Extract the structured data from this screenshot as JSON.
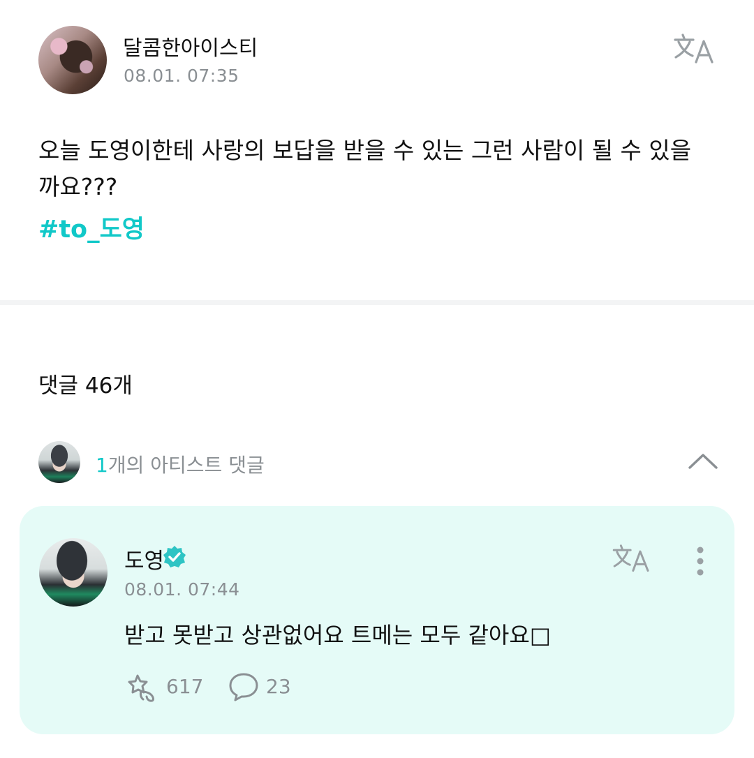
{
  "post": {
    "author": "달콤한아이스티",
    "time": "08.01. 07:35",
    "body": "오늘 도영이한테 사랑의 보답을 받을 수 있는 그런 사람이 될 수 있을까요???",
    "hashtag": "#to_도영"
  },
  "comments": {
    "count_label": "댓글 46개",
    "artist_summary_count": "1",
    "artist_summary_text": "개의 아티스트 댓글"
  },
  "artist_comment": {
    "name": "도영",
    "time": "08.01. 07:44",
    "text": "받고 못받고 상관없어요 트메는 모두 같아요□",
    "likes": "617",
    "replies": "23"
  },
  "colors": {
    "accent": "#11c8c8",
    "card_bg": "#e5fbf7",
    "muted_text": "#8a8f93",
    "verified_badge": "#2ec4c4"
  },
  "icons": [
    "translate-icon",
    "chevron-up-icon",
    "verified-badge-icon",
    "more-vertical-icon",
    "like-icon",
    "reply-bubble-icon"
  ]
}
